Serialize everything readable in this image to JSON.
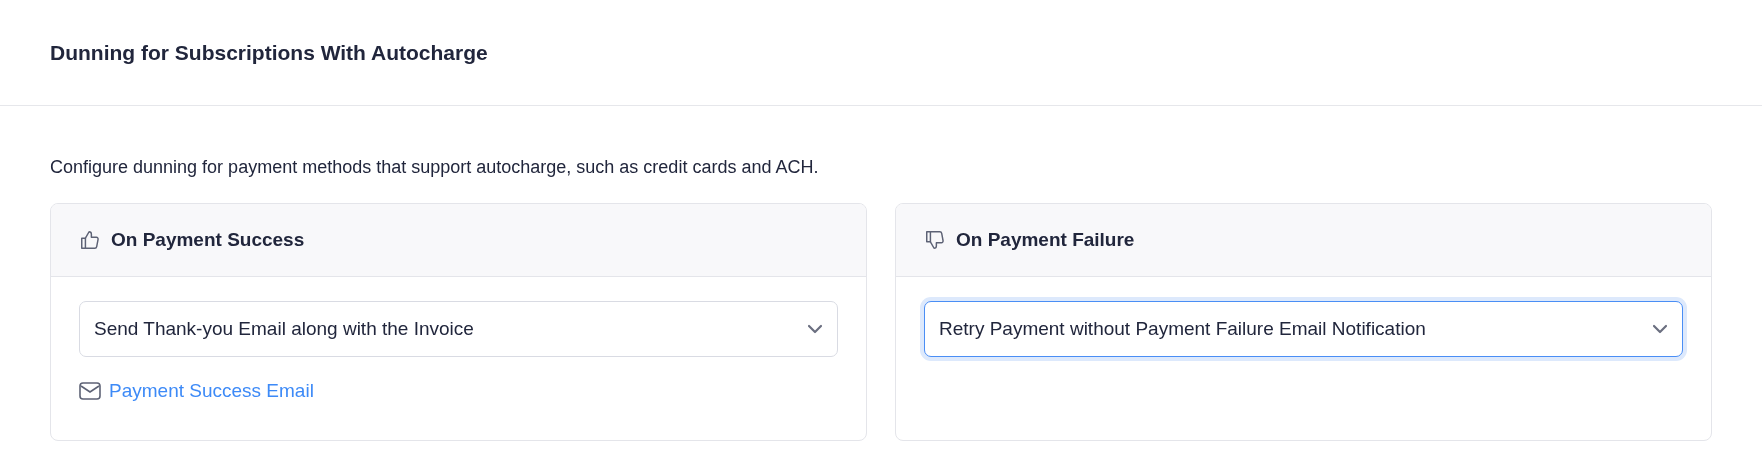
{
  "page": {
    "title": "Dunning for Subscriptions With Autocharge",
    "description": "Configure dunning for payment methods that support autocharge, such as credit cards and ACH."
  },
  "sections": [
    {
      "kind": "success",
      "title": "On Payment Success",
      "select": {
        "value": "Send Thank-you Email along with the Invoice",
        "focused": false
      },
      "link": "Payment Success Email"
    },
    {
      "kind": "failure",
      "title": "On Payment Failure",
      "select": {
        "value": "Retry Payment without Payment Failure Email Notification",
        "focused": true
      }
    }
  ]
}
